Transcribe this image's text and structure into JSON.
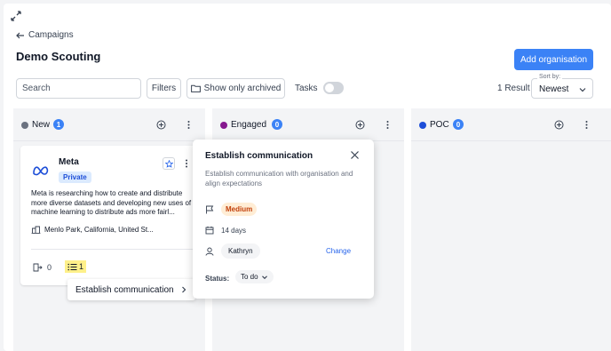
{
  "breadcrumb": {
    "label": "Campaigns"
  },
  "page": {
    "title": "Demo Scouting"
  },
  "header": {
    "add_label": "Add organisation"
  },
  "toolbar": {
    "search_placeholder": "Search",
    "filters_label": "Filters",
    "archived_label": "Show only archived",
    "tasks_label": "Tasks",
    "tasks_toggle_on": false,
    "result_count": "1 Result",
    "sort_label": "Sort by:",
    "sort_value": "Newest"
  },
  "columns": [
    {
      "name": "New",
      "count": "1",
      "color": "#6b7280"
    },
    {
      "name": "Engaged",
      "count": "0",
      "color": "#86198f"
    },
    {
      "name": "POC",
      "count": "0",
      "color": "#1d4ed8"
    }
  ],
  "card": {
    "logo": "meta-logo-icon",
    "title": "Meta",
    "badge": "Private",
    "description": "Meta is researching how to create and distribute more diverse datasets and developing new uses of machine learning to distribute ads more fairl...",
    "location": "Menlo Park, California, United St...",
    "deal_count": "0",
    "task_count": "1"
  },
  "dropdown": {
    "item_label": "Establish communication"
  },
  "popover": {
    "title": "Establish communication",
    "description": "Establish communication with organisation and align expectations",
    "priority": "Medium",
    "duration": "14 days",
    "assignee": "Kathryn",
    "change_label": "Change",
    "status_label": "Status:",
    "status_value": "To do"
  },
  "colors": {
    "primary": "#3b82f6",
    "highlight": "#fef08a",
    "priority": "#c2410c"
  }
}
